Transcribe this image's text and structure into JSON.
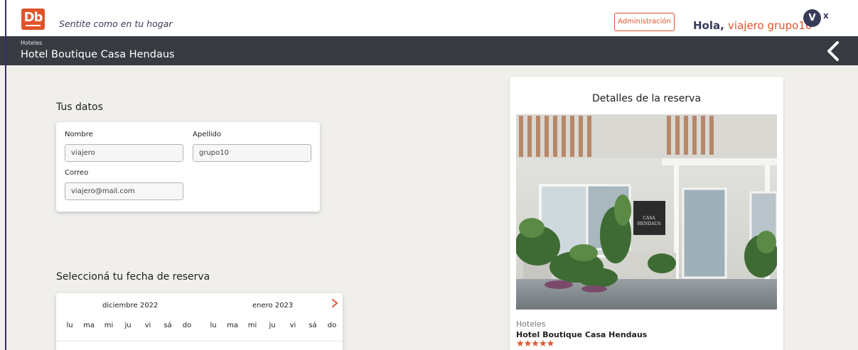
{
  "header": {
    "logo_text": "Db",
    "tagline": "Sentite como en tu hogar",
    "admin_label": "Administración",
    "greeting_prefix": "Hola, ",
    "user_name": "viajero grupo10",
    "avatar_initial": "V",
    "close_label": "x"
  },
  "subheader": {
    "category": "Hoteles",
    "title": "Hotel Boutique Casa Hendaus"
  },
  "datos": {
    "title": "Tus datos",
    "nombre_label": "Nombre",
    "nombre_value": "viajero",
    "apellido_label": "Apellido",
    "apellido_value": "grupo10",
    "correo_label": "Correo",
    "correo_value": "viajero@mail.com"
  },
  "fecha": {
    "title": "Seleccioná tu fecha de reserva",
    "month1": "diciembre 2022",
    "month2": "enero 2023",
    "weekdays": [
      "lu",
      "ma",
      "mi",
      "ju",
      "vi",
      "sá",
      "do"
    ]
  },
  "detalle": {
    "title": "Detalles de la reserva",
    "category": "Hoteles",
    "hotel_name": "Hotel Boutique Casa Hendaus",
    "stars": 5,
    "stars_text": "★★★★★",
    "sign_line1": "CASA",
    "sign_line2": "HENDAUS"
  },
  "colors": {
    "accent": "#e1542a",
    "dark": "#383b41",
    "text": "#383b58",
    "background": "#f0efec"
  }
}
